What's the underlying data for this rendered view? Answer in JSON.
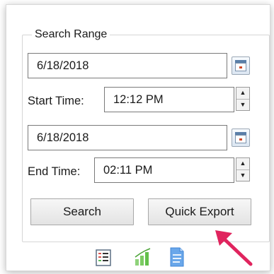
{
  "search_range": {
    "title": "Search Range",
    "start_date": "6/18/2018",
    "start_time_label": "Start Time:",
    "start_time": "12:12 PM",
    "end_date": "6/18/2018",
    "end_time_label": "End Time:",
    "end_time": "02:11 PM",
    "search_label": "Search",
    "quick_export_label": "Quick Export"
  },
  "spinner": {
    "up": "▲",
    "down": "▼"
  },
  "footer_icons": [
    "report-list-icon",
    "chart-icon",
    "document-icon"
  ],
  "colors": {
    "arrow": "#e0245e",
    "chart_green": "#63c04b",
    "doc_blue": "#4a90e2"
  }
}
